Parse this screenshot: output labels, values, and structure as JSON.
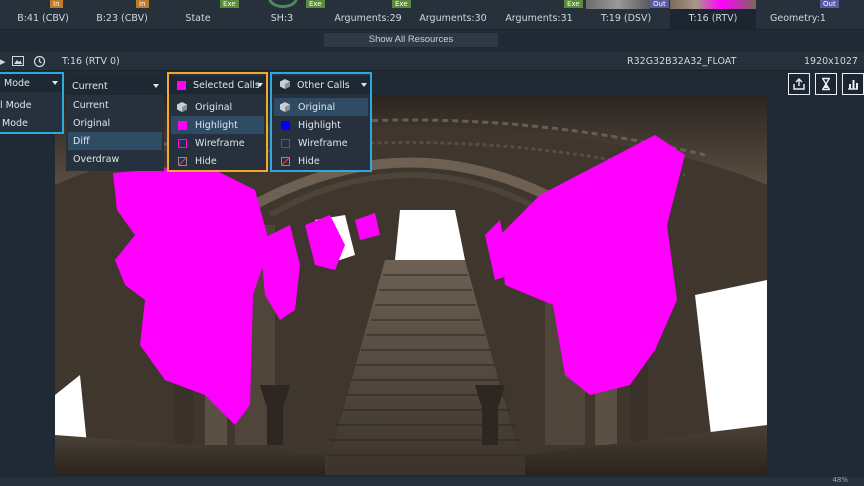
{
  "resource_bar": {
    "cells": [
      {
        "label": "B:41 (CBV)",
        "badge": "In",
        "badge_kind": "in"
      },
      {
        "label": "B:23 (CBV)",
        "badge": "In",
        "badge_kind": "in"
      },
      {
        "label": "State",
        "badge": "Exe",
        "badge_kind": "exe"
      },
      {
        "label": "SH:3",
        "badge": "Exe",
        "badge_kind": "exe"
      },
      {
        "label": "Arguments:29",
        "badge": "",
        "badge_kind": ""
      },
      {
        "label": "Arguments:30",
        "badge": "Exe",
        "badge_kind": "exe"
      },
      {
        "label": "Arguments:31",
        "badge": "Exe",
        "badge_kind": "exe"
      },
      {
        "label": "T:19 (DSV)",
        "badge": "Out",
        "badge_kind": "out"
      },
      {
        "label": "T:16 (RTV)",
        "badge": "Out",
        "badge_kind": "out"
      },
      {
        "label": "Geometry:1",
        "badge": "Out",
        "badge_kind": "out"
      }
    ],
    "show_all_label": "Show All Resources"
  },
  "texture_bar": {
    "name": "T:16 (RTV 0)",
    "format": "R32G32B32A32_FLOAT",
    "size": "1920x1027"
  },
  "mode_panel": {
    "header": "Mode",
    "items": [
      "l Mode",
      "Mode"
    ]
  },
  "view_panel": {
    "header": "Current",
    "items": [
      "Current",
      "Original",
      "Diff",
      "Overdraw"
    ],
    "highlighted": 2
  },
  "selected_calls_panel": {
    "header": "Selected Calls",
    "items": [
      "Original",
      "Highlight",
      "Wireframe",
      "Hide"
    ],
    "highlighted": 1,
    "swatch_color": "#ff00ff"
  },
  "other_calls_panel": {
    "header": "Other Calls",
    "items": [
      "Original",
      "Highlight",
      "Wireframe",
      "Hide"
    ],
    "highlighted": 0,
    "swatch_color": "#0000ff"
  },
  "actions": {
    "icons": [
      "export-icon",
      "hourglass-icon",
      "histogram-icon"
    ]
  },
  "status": {
    "zoom": "48%"
  },
  "colors": {
    "accent_yellow": "#f0a830",
    "accent_blue": "#2fa8e0",
    "highlight_magenta": "#ff00ff"
  }
}
